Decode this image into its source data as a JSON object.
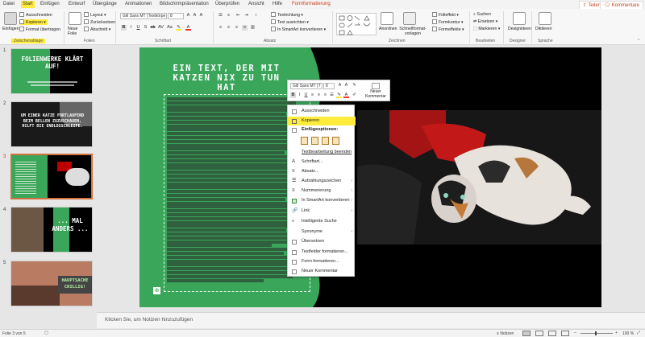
{
  "tabs": [
    "Datei",
    "Start",
    "Einfügen",
    "Entwurf",
    "Übergänge",
    "Animationen",
    "Bildschirmpräsentation",
    "Überprüfen",
    "Ansicht",
    "Hilfe",
    "Formformatierung"
  ],
  "share": "Teilen",
  "comments": "Kommentare",
  "ribbon": {
    "clipboard": {
      "paste": "Einfügen",
      "cut": "Ausschneiden",
      "copy": "Kopieren",
      "format_painter": "Format übertragen",
      "label": "Zwischenablage"
    },
    "slides": {
      "new_slide": "Neue Folie",
      "layout": "Layout",
      "reset": "Zurücksetzen",
      "section": "Abschnitt",
      "label": "Folien"
    },
    "font": {
      "font_name": "Gill Sans MT (Textkörpe",
      "font_size": "8",
      "label": "Schriftart"
    },
    "paragraph": {
      "text_direction": "Textrichtung",
      "align_text": "Text ausrichten",
      "smartart": "In SmartArt konvertieren",
      "label": "Absatz"
    },
    "drawing": {
      "shapes": "Formen",
      "arrange": "Anordnen",
      "quick_styles": "Schnellformat-vorlagen",
      "fill": "Fülleffekt",
      "outline": "Formkontur",
      "effects": "Formeffekte",
      "label": "Zeichnen"
    },
    "editing": {
      "find": "Suchen",
      "replace": "Ersetzen",
      "select": "Markieren",
      "label": "Bearbeiten"
    },
    "designer": {
      "button": "Designideen",
      "label": "Designer"
    },
    "voice": {
      "button": "Diktieren",
      "label": "Sprache"
    }
  },
  "thumbnails": [
    {
      "num": "1",
      "title": "FOLIENWERKE KLÄRT AUF!"
    },
    {
      "num": "2",
      "title": "UM EINER KATZE FORTLAUFEND BEIM BELLEN ZUZUSCHAUEN, HILFT DIE ENDLOSSCHLEIFE."
    },
    {
      "num": "3",
      "title": ""
    },
    {
      "num": "4",
      "title": "... MAL ANDERS ..."
    },
    {
      "num": "5",
      "title": "HAUPTSACHE CHILLIG!"
    }
  ],
  "slide": {
    "title": "EIN TEXT, DER MIT KATZEN NIX ZU TUN HAT"
  },
  "mini_toolbar": {
    "font_name": "Gill Sans MT (T",
    "font_size": "8",
    "new_comment": "Neuer Kommentar"
  },
  "context_menu": {
    "cut": "Ausschneiden",
    "copy": "Kopieren",
    "paste_options": "Einfügeoptionen:",
    "exit_edit": "Textbearbeitung beenden",
    "font": "Schriftart...",
    "paragraph": "Absatz...",
    "bullets": "Aufzählungszeichen",
    "numbering": "Nummerierung",
    "smartart": "In SmartArt konvertieren",
    "link": "Link",
    "smart_lookup": "Intelligente Suche",
    "synonyms": "Synonyme",
    "translate": "Übersetzen",
    "format_textbox": "Textfelder formatieren...",
    "format_shape": "Form formatieren...",
    "new_comment": "Neuer Kommentar"
  },
  "notes_placeholder": "Klicken Sie, um Notizen hinzuzufügen",
  "status": {
    "slide_info": "Folie 3 von 5",
    "notes": "Notizen",
    "zoom": "100 %"
  },
  "colors": {
    "accent": "#c43e1c",
    "slide_green": "#3aa65a",
    "highlight": "#ffeb3b"
  }
}
